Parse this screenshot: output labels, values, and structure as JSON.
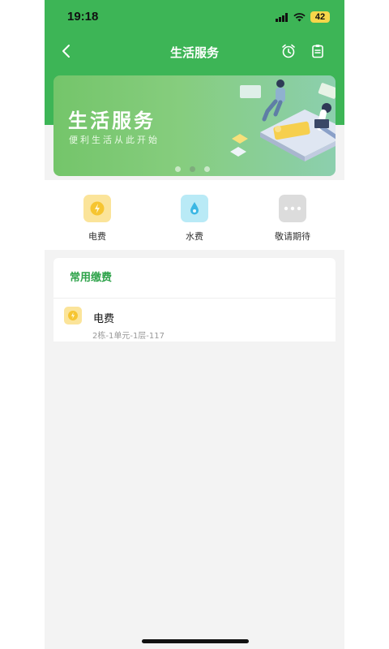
{
  "status_bar": {
    "time": "19:18",
    "battery": "42"
  },
  "nav": {
    "title": "生活服务"
  },
  "banner": {
    "title": "生活服务",
    "subtitle": "便利生活从此开始",
    "slide_count": 3,
    "active_slide": 2
  },
  "services": [
    {
      "label": "电费",
      "icon": "lightning-icon"
    },
    {
      "label": "水费",
      "icon": "water-drop-icon"
    },
    {
      "label": "敬请期待",
      "icon": "more-icon"
    }
  ],
  "common_payments": {
    "title": "常用缴费",
    "items": [
      {
        "name": "电费",
        "detail": "2栋-1单元-1层-117",
        "icon": "lightning-icon"
      }
    ]
  },
  "colors": {
    "header_green": "#3db556",
    "accent_green": "#2ea34a",
    "electric_yellow": "#fbe49a",
    "water_blue": "#b9eaf6"
  }
}
